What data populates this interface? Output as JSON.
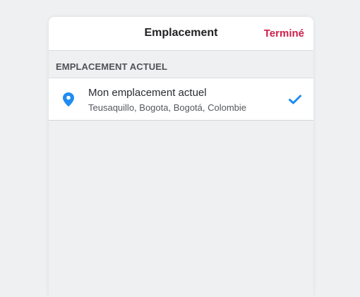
{
  "header": {
    "title": "Emplacement",
    "done_label": "Terminé"
  },
  "section": {
    "title": "EMPLACEMENT ACTUEL"
  },
  "location": {
    "title": "Mon emplacement actuel",
    "subtitle": "Teusaquillo, Bogota, Bogotá, Colombie",
    "icon": "location-pin-icon",
    "selected_icon": "checkmark-icon",
    "selected": true
  },
  "colors": {
    "accent": "#cc1f4a",
    "pin": "#1f8cf0",
    "check": "#1f8cf0",
    "background": "#eff0f2"
  }
}
